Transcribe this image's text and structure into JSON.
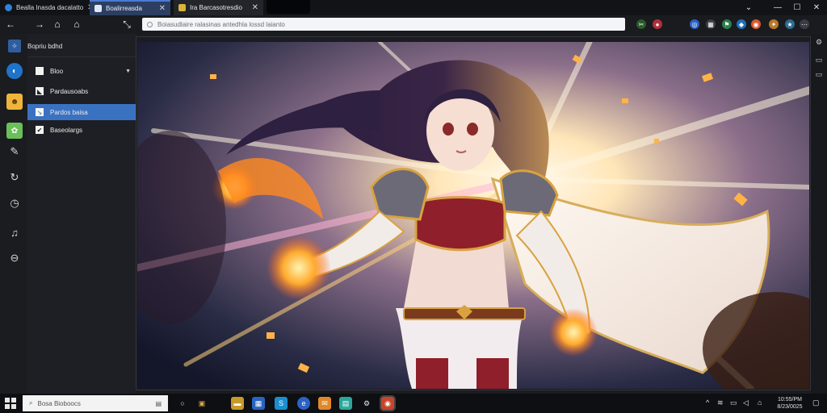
{
  "tabs": [
    {
      "title": "Bealla Inasda dacalatto",
      "close": "✕"
    },
    {
      "title": "Boalirreasda",
      "close": "✕"
    },
    {
      "title": "Ira Barcasotresdio",
      "close": "✕"
    }
  ],
  "window_controls": {
    "chevron": "⌄",
    "minimize": "—",
    "maximize": "☐",
    "close": "✕"
  },
  "nav": {
    "back": "←",
    "forward": "→",
    "home": "⌂",
    "reload": "⟳",
    "pin": "⤡"
  },
  "address_bar": {
    "url": "Boiasudlaire ralasinas antedhla lossd laianto"
  },
  "sidebar": {
    "header": "Bopriu bdhd",
    "items": [
      {
        "label": "Bloo"
      },
      {
        "label": "Pardausoabs"
      },
      {
        "label": "Pardos baisa"
      },
      {
        "label": "Baseolargs"
      }
    ]
  },
  "artwork": {
    "colors": {
      "hair": "#2a1f3a",
      "armor": "#8f1f2b",
      "gold": "#d8a241",
      "cloth": "#f3ecef",
      "fire": "#ff9a2a",
      "light": "#fff3d6"
    }
  },
  "taskbar": {
    "search_placeholder": "Bosa Bioboocs",
    "clock_time": "10:55/PM",
    "clock_date": "8/23/0025"
  },
  "accent": "#3a72c2"
}
